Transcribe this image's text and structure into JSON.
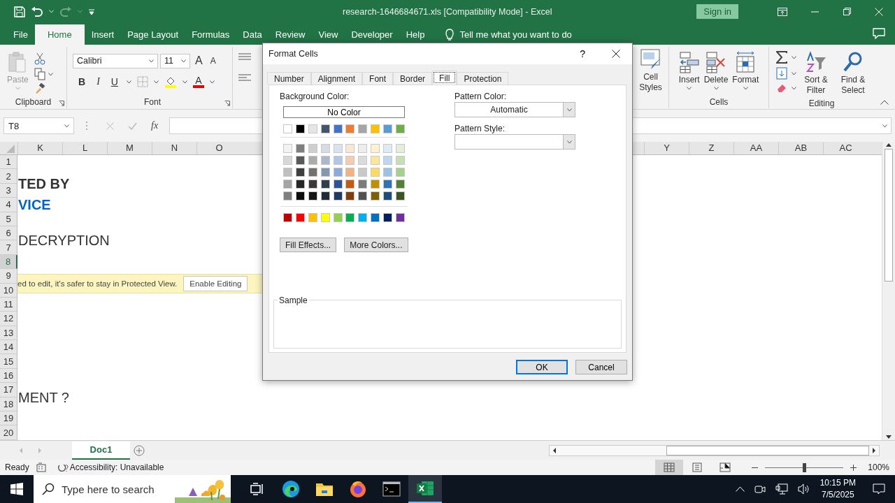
{
  "title_bar": {
    "title": "research-1646684671.xls  [Compatibility Mode]  -  Excel",
    "sign_in": "Sign in"
  },
  "menu_tabs": [
    {
      "label": "File",
      "selected": false
    },
    {
      "label": "Home",
      "selected": true
    },
    {
      "label": "Insert",
      "selected": false
    },
    {
      "label": "Page Layout",
      "selected": false
    },
    {
      "label": "Formulas",
      "selected": false
    },
    {
      "label": "Data",
      "selected": false
    },
    {
      "label": "Review",
      "selected": false
    },
    {
      "label": "View",
      "selected": false
    },
    {
      "label": "Developer",
      "selected": false
    },
    {
      "label": "Help",
      "selected": false
    }
  ],
  "tell_me": "Tell me what you want to do",
  "ribbon": {
    "clipboard": {
      "paste": "Paste",
      "label": "Clipboard"
    },
    "font": {
      "font_name": "Calibri",
      "font_size": "11",
      "grow": "A",
      "shrink": "A",
      "bold": "B",
      "italic": "I",
      "underline": "U",
      "font_color": "A",
      "label": "Font"
    },
    "cell_styles": "Cell Styles",
    "cells": {
      "buttons": [
        {
          "label": "Insert",
          "kind": "insert"
        },
        {
          "label": "Delete",
          "kind": "delete"
        },
        {
          "label": "Format",
          "kind": "format"
        }
      ],
      "label": "Cells"
    },
    "editing": {
      "sort_filter": "Sort & Filter",
      "find_select": "Find & Select",
      "label": "Editing"
    }
  },
  "formula_bar": {
    "name_box": "T8",
    "fx": "fx"
  },
  "sheet": {
    "columns_left": [
      "K",
      "L",
      "M",
      "N",
      "O"
    ],
    "columns_right": [
      "Y",
      "Z",
      "AA",
      "AB",
      "AC"
    ],
    "rows": [
      {
        "number": "1",
        "selected": false
      },
      {
        "number": "2",
        "selected": false,
        "text": "TED BY",
        "kind": "bold"
      },
      {
        "number": "3",
        "selected": false
      },
      {
        "number": "4",
        "selected": false,
        "text": "VICE",
        "kind": "accent"
      },
      {
        "number": "5",
        "selected": false
      },
      {
        "number": "6",
        "selected": false,
        "text": "DECRYPTION",
        "kind": "plain"
      },
      {
        "number": "7",
        "selected": false
      },
      {
        "number": "8",
        "selected": true
      },
      {
        "number": "9",
        "selected": false
      },
      {
        "number": "10",
        "selected": false
      },
      {
        "number": "11",
        "selected": false
      },
      {
        "number": "12",
        "selected": false
      },
      {
        "number": "13",
        "selected": false
      },
      {
        "number": "14",
        "selected": false
      },
      {
        "number": "15",
        "selected": false
      },
      {
        "number": "16",
        "selected": false
      },
      {
        "number": "17",
        "selected": false,
        "text": "MENT ?",
        "kind": "plain"
      },
      {
        "number": "18",
        "selected": false
      },
      {
        "number": "19",
        "selected": false
      },
      {
        "number": "20",
        "selected": false
      }
    ],
    "protected_view": {
      "message": "ed to edit, it's safer to stay in Protected View.",
      "button": "Enable Editing"
    }
  },
  "sheet_tabs": [
    {
      "label": "Doc1",
      "selected": true
    }
  ],
  "status_bar": {
    "ready": "Ready",
    "accessibility": "Accessibility: Unavailable",
    "views": [
      {
        "kind": "normal",
        "selected": true
      },
      {
        "kind": "page_layout",
        "selected": false
      },
      {
        "kind": "page_break",
        "selected": false
      }
    ],
    "zoom_level": {
      "level": 0.5
    },
    "zoom": "100%"
  },
  "taskbar": {
    "search_placeholder": "Type here to search",
    "apps": [
      {
        "kind": "task_view",
        "selected": false
      },
      {
        "kind": "edge",
        "selected": false
      },
      {
        "kind": "explorer",
        "selected": false
      },
      {
        "kind": "firefox",
        "selected": false
      },
      {
        "kind": "terminal",
        "selected": false
      },
      {
        "kind": "excel",
        "selected": true
      }
    ],
    "time": "10:15 PM",
    "date": "7/5/2025"
  },
  "dialog": {
    "title": "Format Cells",
    "help": "?",
    "tabs": [
      {
        "label": "Number",
        "selected": false
      },
      {
        "label": "Alignment",
        "selected": false
      },
      {
        "label": "Font",
        "selected": false
      },
      {
        "label": "Border",
        "selected": false
      },
      {
        "label": "Fill",
        "selected": true
      },
      {
        "label": "Protection",
        "selected": false
      }
    ],
    "background_color_label": "Background Color:",
    "no_color": "No Color",
    "theme_colors": [
      {
        "color": "#ffffff"
      },
      {
        "color": "#000000"
      },
      {
        "color": "#e7e6e6"
      },
      {
        "color": "#44546a"
      },
      {
        "color": "#4472c4"
      },
      {
        "color": "#ed7d31"
      },
      {
        "color": "#a5a5a5"
      },
      {
        "color": "#ffc000"
      },
      {
        "color": "#5b9bd5"
      },
      {
        "color": "#70ad47"
      }
    ],
    "tint_rows": [
      [
        {
          "color": "#f2f2f2"
        },
        {
          "color": "#7f7f7f"
        },
        {
          "color": "#d0cece"
        },
        {
          "color": "#d6dce4"
        },
        {
          "color": "#d9e2f3"
        },
        {
          "color": "#fbe5d5"
        },
        {
          "color": "#ededed"
        },
        {
          "color": "#fff2cc"
        },
        {
          "color": "#deebf6"
        },
        {
          "color": "#e2efd9"
        }
      ],
      [
        {
          "color": "#d8d8d8"
        },
        {
          "color": "#595959"
        },
        {
          "color": "#aeabab"
        },
        {
          "color": "#adb9ca"
        },
        {
          "color": "#b4c6e7"
        },
        {
          "color": "#f7cbac"
        },
        {
          "color": "#dbdbdb"
        },
        {
          "color": "#fee599"
        },
        {
          "color": "#bdd7ee"
        },
        {
          "color": "#c5e0b3"
        }
      ],
      [
        {
          "color": "#bfbfbf"
        },
        {
          "color": "#3f3f3f"
        },
        {
          "color": "#757070"
        },
        {
          "color": "#8496b0"
        },
        {
          "color": "#8eaadb"
        },
        {
          "color": "#f4b183"
        },
        {
          "color": "#c9c9c9"
        },
        {
          "color": "#ffd965"
        },
        {
          "color": "#9cc3e5"
        },
        {
          "color": "#a8d08d"
        }
      ],
      [
        {
          "color": "#a5a5a5"
        },
        {
          "color": "#262626"
        },
        {
          "color": "#3a3838"
        },
        {
          "color": "#323f4f"
        },
        {
          "color": "#2f5496"
        },
        {
          "color": "#c55a11"
        },
        {
          "color": "#7b7b7b"
        },
        {
          "color": "#bf9000"
        },
        {
          "color": "#2e75b5"
        },
        {
          "color": "#538135"
        }
      ],
      [
        {
          "color": "#7f7f7f"
        },
        {
          "color": "#0c0c0c"
        },
        {
          "color": "#171616"
        },
        {
          "color": "#222a35"
        },
        {
          "color": "#1f3864"
        },
        {
          "color": "#833c0b"
        },
        {
          "color": "#525252"
        },
        {
          "color": "#7f6000"
        },
        {
          "color": "#1e4e79"
        },
        {
          "color": "#375623"
        }
      ]
    ],
    "standard_colors": [
      {
        "color": "#c00000"
      },
      {
        "color": "#ff0000"
      },
      {
        "color": "#ffc000"
      },
      {
        "color": "#ffff00"
      },
      {
        "color": "#92d050"
      },
      {
        "color": "#00b050"
      },
      {
        "color": "#00b0f0"
      },
      {
        "color": "#0070c0"
      },
      {
        "color": "#002060"
      },
      {
        "color": "#7030a0"
      }
    ],
    "fill_effects": "Fill Effects...",
    "more_colors": "More Colors...",
    "pattern_color_label": "Pattern Color:",
    "pattern_color": "Automatic",
    "pattern_style_label": "Pattern Style:",
    "sample_label": "Sample",
    "ok": "OK",
    "cancel": "Cancel"
  }
}
